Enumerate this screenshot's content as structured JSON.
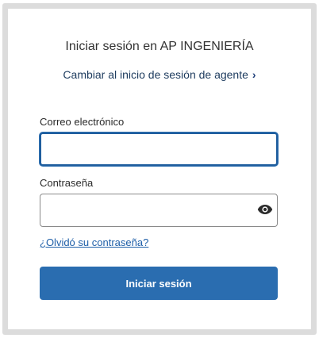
{
  "login": {
    "title": "Iniciar sesión en AP INGENIERÍA",
    "agent_link": "Cambiar al inicio de sesión de agente",
    "agent_link_chevron": "›",
    "email_label": "Correo electrónico",
    "email_value": "",
    "password_label": "Contraseña",
    "password_value": "",
    "forgot_link": "¿Olvidó su contraseña?",
    "submit_label": "Iniciar sesión"
  },
  "icons": {
    "password_toggle": "eye-icon"
  },
  "colors": {
    "primary": "#2a6db0",
    "focus_border": "#1f5e9e",
    "link": "#1f5fa8",
    "frame": "#dcdcdc"
  }
}
